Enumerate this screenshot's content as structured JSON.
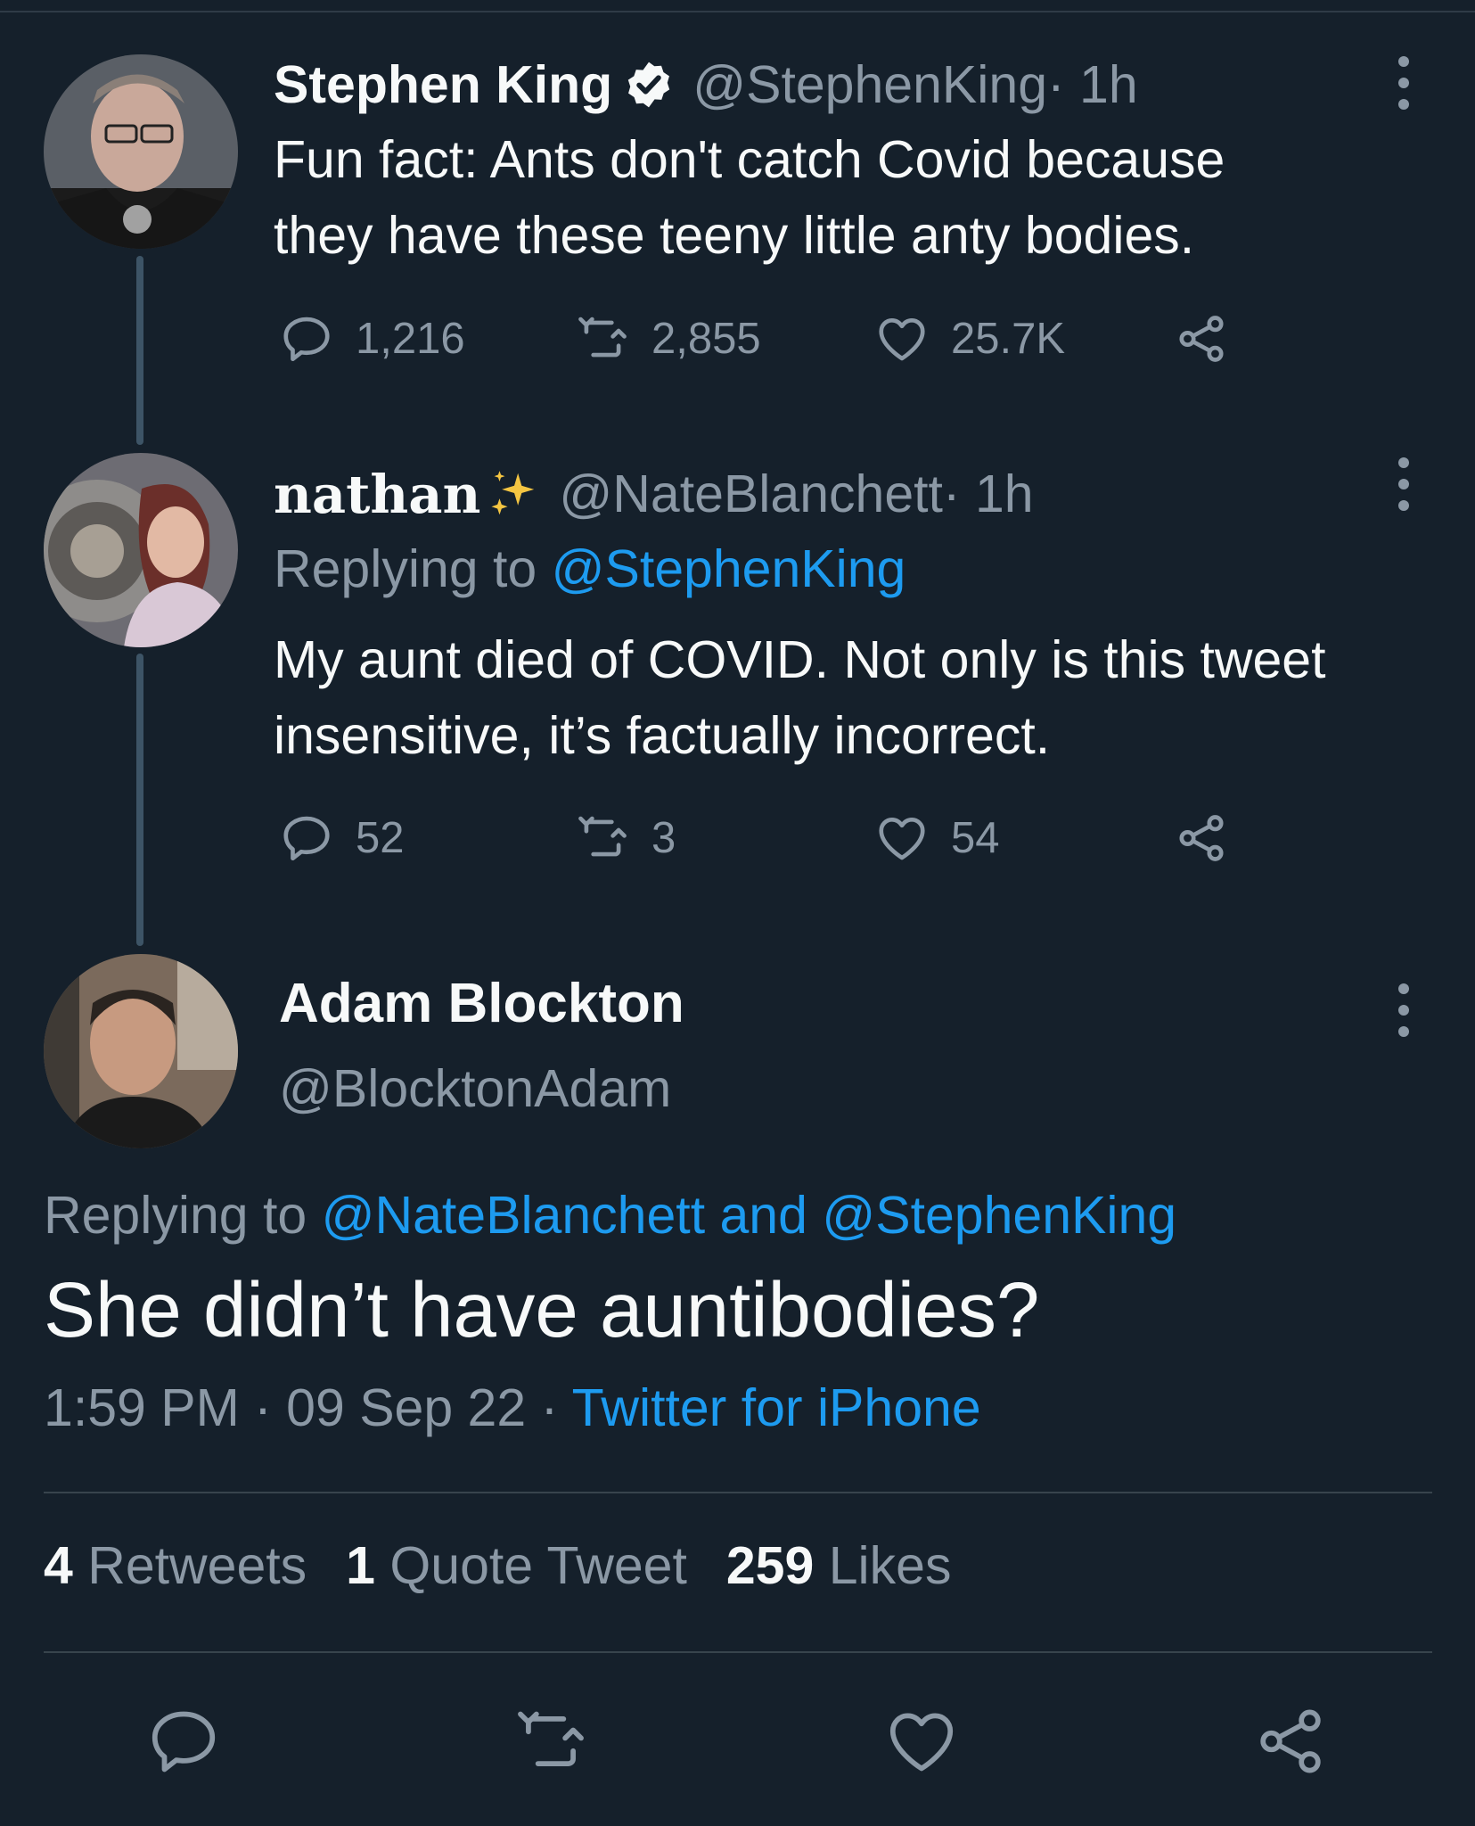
{
  "colors": {
    "background": "#15202b",
    "text": "#f7f9f9",
    "secondary": "#8b98a5",
    "link": "#1d9bf0",
    "thread_line": "#3d5466"
  },
  "tweets": [
    {
      "name": "Stephen King",
      "verified": true,
      "handle": "@StephenKing",
      "time": " · 1h",
      "text_lines": [
        "Fun fact: Ants don't catch Covid because",
        "they have these teeny little anty bodies."
      ],
      "replies": "1,216",
      "retweets": "2,855",
      "likes": "25.7K"
    },
    {
      "name": "nathan",
      "handle": "@NateBlanchett",
      "time": " · 1h",
      "replying_label": "Replying to ",
      "replying_to": "@StephenKing",
      "text_lines": [
        "My aunt died of COVID. Not only is this tweet",
        "insensitive, it’s factually incorrect."
      ],
      "replies": "52",
      "retweets": "3",
      "likes": "54"
    }
  ],
  "main_tweet": {
    "name": "Adam Blockton",
    "handle": "@BlocktonAdam",
    "replying_label": "Replying to ",
    "replying_to": "@NateBlanchett and @StephenKing",
    "text": "She didn’t have auntibodies?",
    "time": "1:59 PM",
    "sep1": " · ",
    "date": "09 Sep 22",
    "sep2": " · ",
    "source": "Twitter for iPhone",
    "retweets_count": "4",
    "retweets_label": " Retweets",
    "quotes_count": "1",
    "quotes_label": " Quote Tweet",
    "likes_count": "259",
    "likes_label": " Likes"
  },
  "icons": {
    "reply": "speech-bubble-icon",
    "retweet": "retweet-icon",
    "like": "heart-icon",
    "share": "share-icon",
    "more": "more-dots-icon",
    "verified": "verified-badge-icon",
    "sparkle": "sparkles-emoji-icon"
  }
}
